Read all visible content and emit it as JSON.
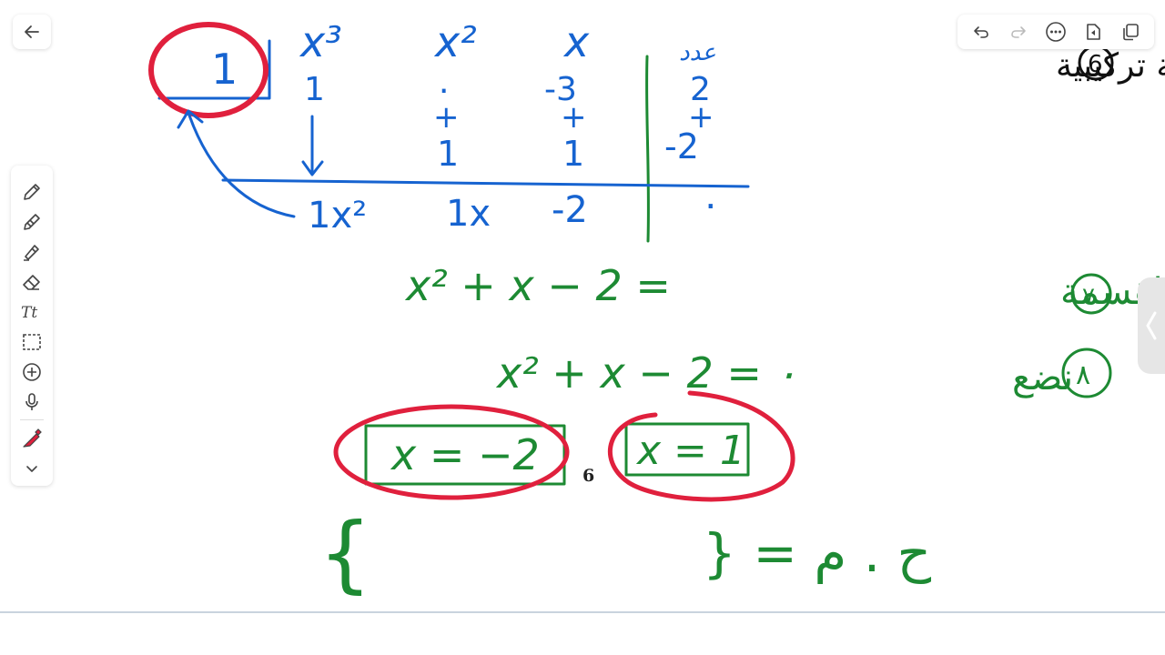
{
  "toolbar": {
    "back_icon": "arrow-left-icon",
    "top_icons": [
      "undo-icon",
      "redo-icon",
      "more-icon",
      "shape-icon",
      "copy-icon"
    ],
    "left_tools": [
      "pen-icon",
      "pencil-icon",
      "highlighter-icon",
      "eraser-icon",
      "text-icon",
      "lasso-select-icon",
      "add-icon",
      "microphone-icon",
      "color-swatch-icon",
      "chevron-down-icon"
    ],
    "side_tab_icon": "chevron-left-icon"
  },
  "board": {
    "divisor": "1",
    "col_x3": "x³",
    "col_x2": "x²",
    "col_x": "x",
    "col_const": "عدد",
    "coef_row": [
      "1",
      "٠",
      "-3",
      "2"
    ],
    "plus_row": [
      "+",
      "+",
      "+"
    ],
    "mult_row": [
      "1",
      "1",
      "-2"
    ],
    "result_row": [
      "1x²",
      "1x",
      "-2",
      "٠"
    ],
    "step6_num": "6",
    "step6_label": "قسمة تركيبية",
    "step7_num": "٧",
    "step7_label": "ناتج القسمة",
    "quotient": "x² + x − 2  =",
    "step8_num": "٨",
    "step8_label": "نضع",
    "equation": "x² + x − 2 = ٠",
    "root1": "x = −2",
    "root2": "x = 1",
    "solution_set_label": "} = ح . م",
    "brace_open": "{"
  },
  "page_number": "6",
  "colors": {
    "blue_ink": "#1663d0",
    "green_ink": "#1d8a33",
    "red_ink": "#e0203d",
    "black_ink": "#111111"
  }
}
